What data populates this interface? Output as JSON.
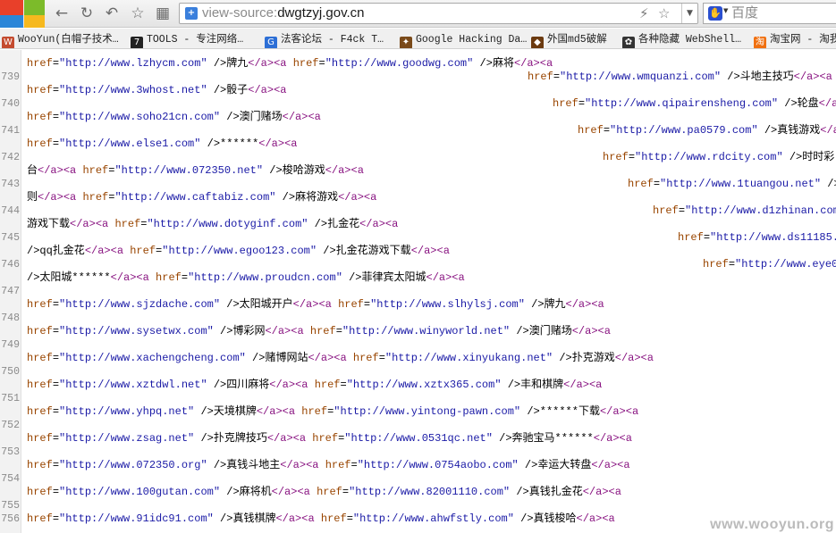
{
  "toolbar": {
    "url_scheme": "view-source:",
    "url_host": "dwgtzyj.gov.cn",
    "search_placeholder": "百度",
    "back_icon": "arrow-left-icon",
    "refresh_icon": "refresh-icon",
    "undo_icon": "undo-icon",
    "star_icon": "star-icon",
    "grid_icon": "grid-icon"
  },
  "bookmarks": [
    {
      "label": "WooYun(白帽子技术…",
      "icon_color": "#c44b2f",
      "glyph": "W"
    },
    {
      "label": "TOOLS - 专注网络…",
      "icon_color": "#222222",
      "glyph": "7"
    },
    {
      "label": "法客论坛 - F4ck T…",
      "icon_color": "#2d6fd6",
      "glyph": "G"
    },
    {
      "label": "Google Hacking Da…",
      "icon_color": "#7a4a1a",
      "glyph": "✦"
    },
    {
      "label": "外国md5破解",
      "icon_color": "#6b3a10",
      "glyph": "◆"
    },
    {
      "label": "各种隐藏 WebShell…",
      "icon_color": "#333333",
      "glyph": "✿"
    },
    {
      "label": "淘宝网 - 淘我喜",
      "icon_color": "#f07010",
      "glyph": "淘"
    }
  ],
  "source_lines": [
    {
      "num": "739",
      "segments": [
        [
          "attr",
          "href"
        ],
        [
          "txt",
          "="
        ],
        [
          "val",
          "\"http://www.lzhycm.com\""
        ],
        [
          "txt",
          " />牌九"
        ],
        [
          "tag",
          "</a><a"
        ],
        [
          "txt",
          " "
        ],
        [
          "attr",
          "href"
        ],
        [
          "txt",
          "="
        ],
        [
          "val",
          "\"http://www.goodwg.com\""
        ],
        [
          "txt",
          " />麻将"
        ],
        [
          "tag",
          "</a><a"
        ]
      ]
    },
    {
      "num": "740",
      "segments": [
        [
          "attr",
          "href"
        ],
        [
          "txt",
          "="
        ],
        [
          "val",
          "\"http://www.wmquanzi.com\""
        ],
        [
          "txt",
          " />斗地主技巧"
        ],
        [
          "tag",
          "</a><a"
        ]
      ]
    },
    {
      "num": "",
      "segments": [
        [
          "attr",
          "href"
        ],
        [
          "txt",
          "="
        ],
        [
          "val",
          "\"http://www.3whost.net\""
        ],
        [
          "txt",
          " />骰子"
        ],
        [
          "tag",
          "</a><a"
        ]
      ]
    },
    {
      "num": "741",
      "segments": [
        [
          "attr",
          "href"
        ],
        [
          "txt",
          "="
        ],
        [
          "val",
          "\"http://www.qipairensheng.com\""
        ],
        [
          "txt",
          " />轮盘"
        ],
        [
          "tag",
          "</a><a"
        ]
      ]
    },
    {
      "num": "",
      "segments": [
        [
          "attr",
          "href"
        ],
        [
          "txt",
          "="
        ],
        [
          "val",
          "\"http://www.soho21cn.com\""
        ],
        [
          "txt",
          " />澳门赌场"
        ],
        [
          "tag",
          "</a><a"
        ]
      ]
    },
    {
      "num": "742",
      "segments": [
        [
          "attr",
          "href"
        ],
        [
          "txt",
          "="
        ],
        [
          "val",
          "\"http://www.pa0579.com\""
        ],
        [
          "txt",
          " />真钱游戏"
        ],
        [
          "tag",
          "</a><a"
        ]
      ]
    },
    {
      "num": "",
      "segments": [
        [
          "attr",
          "href"
        ],
        [
          "txt",
          "="
        ],
        [
          "val",
          "\"http://www.else1.com\""
        ],
        [
          "txt",
          " />******"
        ],
        [
          "tag",
          "</a><a"
        ]
      ]
    },
    {
      "num": "743",
      "segments": [
        [
          "attr",
          "href"
        ],
        [
          "txt",
          "="
        ],
        [
          "val",
          "\"http://www.rdcity.com\""
        ],
        [
          "txt",
          " />时时彩"
        ]
      ]
    },
    {
      "num": "",
      "segments": [
        [
          "txt",
          "台"
        ],
        [
          "tag",
          "</a><a"
        ],
        [
          "txt",
          " "
        ],
        [
          "attr",
          "href"
        ],
        [
          "txt",
          "="
        ],
        [
          "val",
          "\"http://www.072350.net\""
        ],
        [
          "txt",
          " />梭哈游戏"
        ],
        [
          "tag",
          "</a><a"
        ]
      ]
    },
    {
      "num": "744",
      "segments": [
        [
          "attr",
          "href"
        ],
        [
          "txt",
          "="
        ],
        [
          "val",
          "\"http://www.1tuangou.net\""
        ],
        [
          "txt",
          " />"
        ]
      ]
    },
    {
      "num": "",
      "segments": [
        [
          "txt",
          "则"
        ],
        [
          "tag",
          "</a><a"
        ],
        [
          "txt",
          " "
        ],
        [
          "attr",
          "href"
        ],
        [
          "txt",
          "="
        ],
        [
          "val",
          "\"http://www.caftabiz.com\""
        ],
        [
          "txt",
          " />麻将游戏"
        ],
        [
          "tag",
          "</a><a"
        ]
      ]
    },
    {
      "num": "745",
      "segments": [
        [
          "attr",
          "href"
        ],
        [
          "txt",
          "="
        ],
        [
          "val",
          "\"http://www.d1zhinan.com\""
        ]
      ]
    },
    {
      "num": "",
      "segments": [
        [
          "txt",
          "游戏下载"
        ],
        [
          "tag",
          "</a><a"
        ],
        [
          "txt",
          " "
        ],
        [
          "attr",
          "href"
        ],
        [
          "txt",
          "="
        ],
        [
          "val",
          "\"http://www.dotyginf.com\""
        ],
        [
          "txt",
          " />扎金花"
        ],
        [
          "tag",
          "</a><a"
        ]
      ]
    },
    {
      "num": "746",
      "segments": [
        [
          "attr",
          "href"
        ],
        [
          "txt",
          "="
        ],
        [
          "val",
          "\"http://www.ds11185.c"
        ]
      ]
    },
    {
      "num": "",
      "segments": [
        [
          "txt",
          "/>qq扎金花"
        ],
        [
          "tag",
          "</a><a"
        ],
        [
          "txt",
          " "
        ],
        [
          "attr",
          "href"
        ],
        [
          "txt",
          "="
        ],
        [
          "val",
          "\"http://www.egoo123.com\""
        ],
        [
          "txt",
          " />扎金花游戏下载"
        ],
        [
          "tag",
          "</a><a"
        ]
      ]
    },
    {
      "num": "747",
      "segments": [
        [
          "attr",
          "href"
        ],
        [
          "txt",
          "="
        ],
        [
          "val",
          "\"http://www.eye0"
        ]
      ]
    },
    {
      "num": "",
      "segments": [
        [
          "txt",
          "/>太阳城******"
        ],
        [
          "tag",
          "</a><a"
        ],
        [
          "txt",
          " "
        ],
        [
          "attr",
          "href"
        ],
        [
          "txt",
          "="
        ],
        [
          "val",
          "\"http://www.proudcn.com\""
        ],
        [
          "txt",
          " />菲律宾太阳城"
        ],
        [
          "tag",
          "</a><a"
        ]
      ]
    },
    {
      "num": "748",
      "segments": [
        [
          "attr",
          "href"
        ],
        [
          "txt",
          "="
        ],
        [
          "val",
          "\"http://www.sjzdache.com\""
        ],
        [
          "txt",
          " />太阳城开户"
        ],
        [
          "tag",
          "</a><a"
        ],
        [
          "txt",
          " "
        ],
        [
          "attr",
          "href"
        ],
        [
          "txt",
          "="
        ],
        [
          "val",
          "\"http://www.slhylsj.com\""
        ],
        [
          "txt",
          " />牌九"
        ],
        [
          "tag",
          "</a><a"
        ]
      ]
    },
    {
      "num": "749",
      "segments": [
        [
          "attr",
          "href"
        ],
        [
          "txt",
          "="
        ],
        [
          "val",
          "\"http://www.sysetwx.com\""
        ],
        [
          "txt",
          " />博彩网"
        ],
        [
          "tag",
          "</a><a"
        ],
        [
          "txt",
          " "
        ],
        [
          "attr",
          "href"
        ],
        [
          "txt",
          "="
        ],
        [
          "val",
          "\"http://www.winyworld.net\""
        ],
        [
          "txt",
          " />澳门赌场"
        ],
        [
          "tag",
          "</a><a"
        ]
      ]
    },
    {
      "num": "750",
      "segments": [
        [
          "attr",
          "href"
        ],
        [
          "txt",
          "="
        ],
        [
          "val",
          "\"http://www.xachengcheng.com\""
        ],
        [
          "txt",
          " />赌博网站"
        ],
        [
          "tag",
          "</a><a"
        ],
        [
          "txt",
          " "
        ],
        [
          "attr",
          "href"
        ],
        [
          "txt",
          "="
        ],
        [
          "val",
          "\"http://www.xinyukang.net\""
        ],
        [
          "txt",
          " />扑克游戏"
        ],
        [
          "tag",
          "</a><a"
        ]
      ]
    },
    {
      "num": "751",
      "segments": [
        [
          "attr",
          "href"
        ],
        [
          "txt",
          "="
        ],
        [
          "val",
          "\"http://www.xztdwl.net\""
        ],
        [
          "txt",
          " />四川麻将"
        ],
        [
          "tag",
          "</a><a"
        ],
        [
          "txt",
          " "
        ],
        [
          "attr",
          "href"
        ],
        [
          "txt",
          "="
        ],
        [
          "val",
          "\"http://www.xztx365.com\""
        ],
        [
          "txt",
          " />丰和棋牌"
        ],
        [
          "tag",
          "</a><a"
        ]
      ]
    },
    {
      "num": "752",
      "segments": [
        [
          "attr",
          "href"
        ],
        [
          "txt",
          "="
        ],
        [
          "val",
          "\"http://www.yhpq.net\""
        ],
        [
          "txt",
          " />天境棋牌"
        ],
        [
          "tag",
          "</a><a"
        ],
        [
          "txt",
          " "
        ],
        [
          "attr",
          "href"
        ],
        [
          "txt",
          "="
        ],
        [
          "val",
          "\"http://www.yintong-pawn.com\""
        ],
        [
          "txt",
          " />******下载"
        ],
        [
          "tag",
          "</a><a"
        ]
      ]
    },
    {
      "num": "753",
      "segments": [
        [
          "attr",
          "href"
        ],
        [
          "txt",
          "="
        ],
        [
          "val",
          "\"http://www.zsag.net\""
        ],
        [
          "txt",
          " />扑克牌技巧"
        ],
        [
          "tag",
          "</a><a"
        ],
        [
          "txt",
          " "
        ],
        [
          "attr",
          "href"
        ],
        [
          "txt",
          "="
        ],
        [
          "val",
          "\"http://www.0531qc.net\""
        ],
        [
          "txt",
          " />奔驰宝马******"
        ],
        [
          "tag",
          "</a><a"
        ]
      ]
    },
    {
      "num": "754",
      "segments": [
        [
          "attr",
          "href"
        ],
        [
          "txt",
          "="
        ],
        [
          "val",
          "\"http://www.072350.org\""
        ],
        [
          "txt",
          " />真钱斗地主"
        ],
        [
          "tag",
          "</a><a"
        ],
        [
          "txt",
          " "
        ],
        [
          "attr",
          "href"
        ],
        [
          "txt",
          "="
        ],
        [
          "val",
          "\"http://www.0754aobo.com\""
        ],
        [
          "txt",
          " />幸运大转盘"
        ],
        [
          "tag",
          "</a><a"
        ]
      ]
    },
    {
      "num": "755",
      "segments": [
        [
          "attr",
          "href"
        ],
        [
          "txt",
          "="
        ],
        [
          "val",
          "\"http://www.100gutan.com\""
        ],
        [
          "txt",
          " />麻将机"
        ],
        [
          "tag",
          "</a><a"
        ],
        [
          "txt",
          " "
        ],
        [
          "attr",
          "href"
        ],
        [
          "txt",
          "="
        ],
        [
          "val",
          "\"http://www.82001110.com\""
        ],
        [
          "txt",
          " />真钱扎金花"
        ],
        [
          "tag",
          "</a><a"
        ]
      ]
    },
    {
      "num": "756",
      "segments": [
        [
          "attr",
          "href"
        ],
        [
          "txt",
          "="
        ],
        [
          "val",
          "\"http://www.91idc91.com\""
        ],
        [
          "txt",
          " />真钱棋牌"
        ],
        [
          "tag",
          "</a><a"
        ],
        [
          "txt",
          " "
        ],
        [
          "attr",
          "href"
        ],
        [
          "txt",
          "="
        ],
        [
          "val",
          "\"http://www.ahwfstly.com\""
        ],
        [
          "txt",
          " />真钱梭哈"
        ],
        [
          "tag",
          "</a><a"
        ]
      ]
    }
  ],
  "watermark": "www.wooyun.org"
}
